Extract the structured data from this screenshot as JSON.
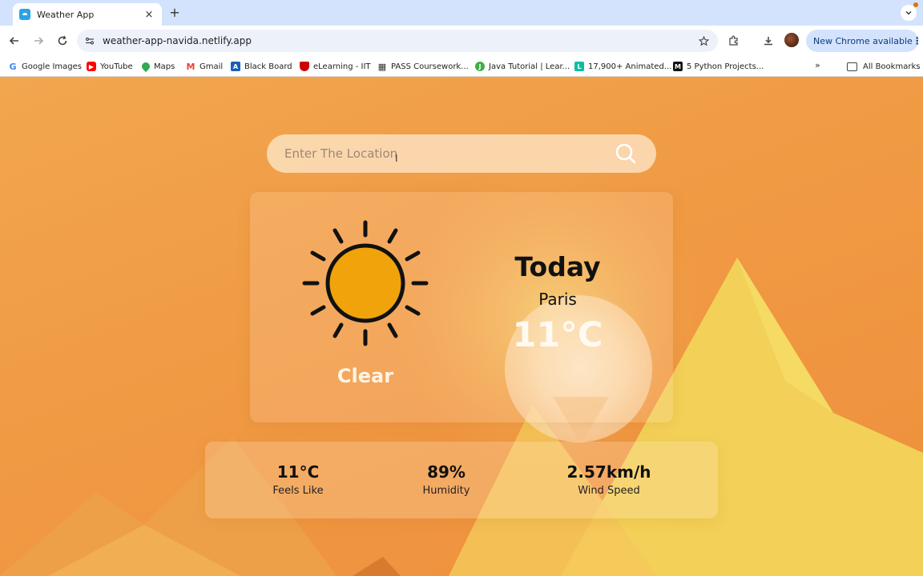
{
  "browser": {
    "tab_title": "Weather App",
    "tab_close": "×",
    "new_tab": "+",
    "url": "weather-app-navida.netlify.app",
    "update_label": "New Chrome available",
    "menu": "⋮"
  },
  "bookmarks": {
    "items": [
      {
        "label": "Google Images",
        "icon": "google-icon",
        "color": "#4285f4"
      },
      {
        "label": "YouTube",
        "icon": "youtube-icon",
        "color": "#ff0000"
      },
      {
        "label": "Maps",
        "icon": "maps-icon",
        "color": "#34a853"
      },
      {
        "label": "Gmail",
        "icon": "gmail-icon",
        "color": "#ea4335"
      },
      {
        "label": "Black Board",
        "icon": "blackboard-icon",
        "color": "#1a5fb4"
      },
      {
        "label": "eLearning - IIT",
        "icon": "iit-shield-icon",
        "color": "#cc0000"
      },
      {
        "label": "PASS Coursework...",
        "icon": "grid-icon",
        "color": "#333333"
      },
      {
        "label": "Java Tutorial | Lear...",
        "icon": "java-icon",
        "color": "#3cb043"
      },
      {
        "label": "17,900+ Animated...",
        "icon": "lottie-icon",
        "color": "#00c1a2"
      },
      {
        "label": "5 Python Projects...",
        "icon": "medium-icon",
        "color": "#111111"
      }
    ],
    "overflow": "»",
    "all_bookmarks": "All Bookmarks"
  },
  "search": {
    "placeholder": "Enter The Location",
    "value": ""
  },
  "weather": {
    "condition": "Clear",
    "day": "Today",
    "city": "Paris",
    "temperature": "11°C",
    "icon": "sun-icon"
  },
  "details": {
    "feels_like": {
      "value": "11°C",
      "label": "Feels Like"
    },
    "humidity": {
      "value": "89%",
      "label": "Humidity"
    },
    "wind_speed": {
      "value": "2.57km/h",
      "label": "Wind Speed"
    }
  },
  "colors": {
    "background": "#f0a04a",
    "mountain_yellow": "#f2d45a",
    "sun_fill": "#f0a30a",
    "card_text": "#fff4e6"
  }
}
